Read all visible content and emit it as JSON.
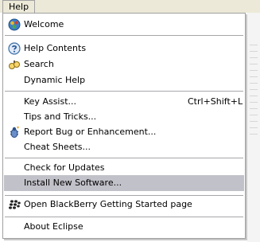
{
  "menubar": {
    "help_label": "Help"
  },
  "menu": {
    "welcome": "Welcome",
    "help_contents": "Help Contents",
    "search": "Search",
    "dynamic_help": "Dynamic Help",
    "key_assist": "Key Assist...",
    "key_assist_shortcut": "Ctrl+Shift+L",
    "tips_and_tricks": "Tips and Tricks...",
    "report_bug": "Report Bug or Enhancement...",
    "cheat_sheets": "Cheat Sheets...",
    "check_for_updates": "Check for Updates",
    "install_new_software": "Install New Software...",
    "open_blackberry": "Open BlackBerry Getting Started page",
    "about_eclipse": "About Eclipse"
  },
  "icons": {
    "welcome": "welcome-globe-icon",
    "help_contents": "help-question-icon",
    "search": "search-binoculars-icon",
    "report_bug": "bug-report-icon",
    "blackberry": "blackberry-logo-icon"
  },
  "colors": {
    "selection": "#c1c1c9",
    "menubar": "#ece9d8",
    "separator": "#a7a6aa"
  },
  "state": {
    "selected_item": "Install New Software..."
  }
}
